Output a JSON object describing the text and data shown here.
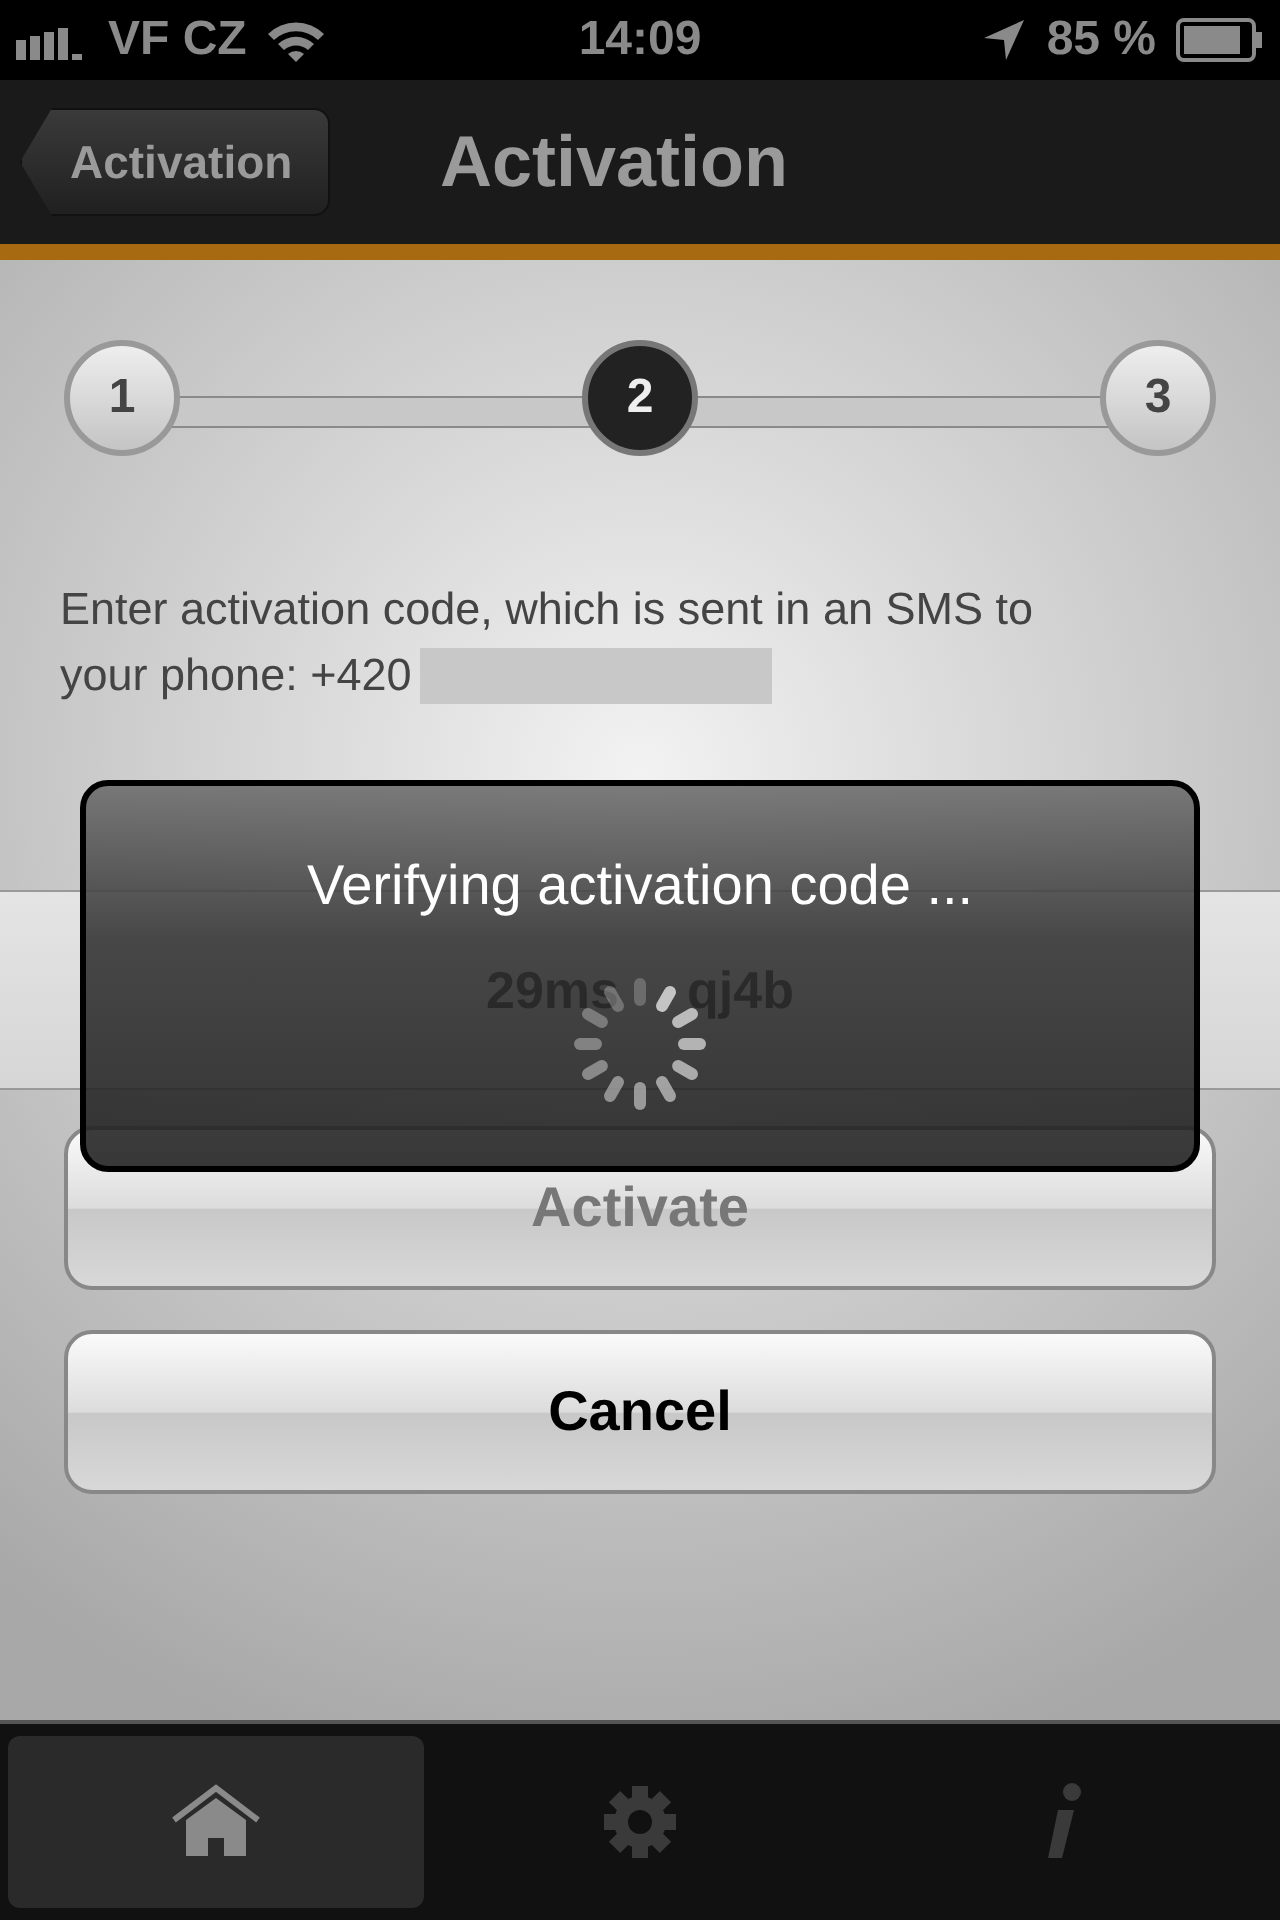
{
  "status_bar": {
    "carrier": "VF CZ",
    "time": "14:09",
    "battery": "85 %"
  },
  "nav_bar": {
    "back_button": "Activation",
    "title": "Activation"
  },
  "stepper": [
    {
      "label": "1",
      "selected": false
    },
    {
      "label": "2",
      "selected": true
    },
    {
      "label": "3",
      "selected": false
    }
  ],
  "instructions": [
    "Enter activation code, which is sent in an SMS to",
    "your phone: +420"
  ],
  "code_field": {
    "value_start": "29ms",
    "value_end": "qj4b"
  },
  "buttons": [
    {
      "label": "Activate",
      "disabled": true
    },
    {
      "label": "Cancel",
      "disabled": false
    }
  ],
  "hud": {
    "message": "Verifying activation code ..."
  },
  "tab_bar": [
    {
      "kind": "home",
      "selected": true
    },
    {
      "kind": "settings",
      "selected": false
    },
    {
      "kind": "info",
      "selected": false
    }
  ]
}
